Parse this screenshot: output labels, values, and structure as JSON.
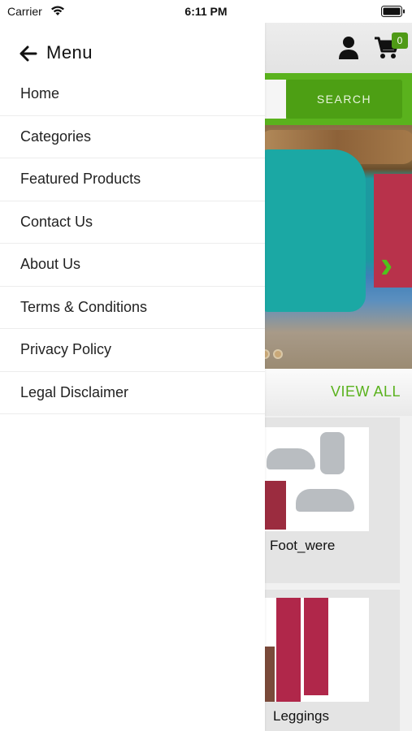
{
  "status_bar": {
    "carrier": "Carrier",
    "time": "6:11 PM"
  },
  "background_app": {
    "cart": {
      "count": "0"
    },
    "search": {
      "button_label": "SEARCH",
      "placeholder": ""
    },
    "section": {
      "view_all_label": "VIEW ALL"
    },
    "products": [
      {
        "name": "Foot_were"
      },
      {
        "name": "Leggings"
      }
    ],
    "colors": {
      "accent": "#5ab21d",
      "accent_dark": "#4d9f14"
    },
    "icons": [
      "user-icon",
      "cart-icon",
      "chevron-right-icon"
    ]
  },
  "drawer": {
    "title": "Menu",
    "back_icon": "arrow-left-icon",
    "items": [
      {
        "label": "Home"
      },
      {
        "label": "Categories"
      },
      {
        "label": "Featured Products"
      },
      {
        "label": "Contact Us"
      },
      {
        "label": "About Us"
      },
      {
        "label": "Terms & Conditions"
      },
      {
        "label": "Privacy Policy"
      },
      {
        "label": "Legal Disclaimer"
      }
    ]
  }
}
